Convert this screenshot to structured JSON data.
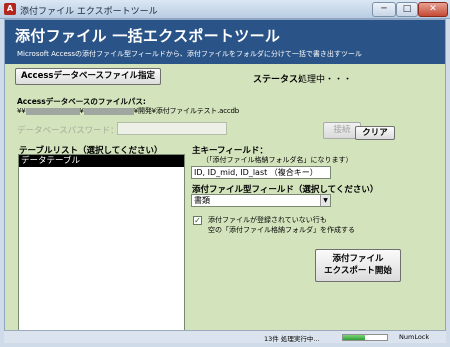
{
  "window": {
    "title": "添付ファイル エクスポートツール",
    "app_icon_letter": "A",
    "controls": {
      "minimize": "─",
      "maximize": "□",
      "close": "✕"
    }
  },
  "banner": {
    "title": "添付ファイル 一括エクスポートツール",
    "subtitle": "Microsoft Accessの添付ファイル型フィールドから、添付ファイルをフォルダに分けて一括で書き出すツール"
  },
  "database": {
    "select_button": "Accessデータベースファイル指定",
    "path_label": "Accessデータベースのファイルパス:",
    "path_prefix": "¥¥",
    "path_sep": "¥",
    "path_suffix": "¥開発¥添付ファイルテスト.accdb",
    "password_label": "データベースパスワード：",
    "password_value": "",
    "connect_button": "接続",
    "clear_button": "クリア"
  },
  "status": {
    "label": "ステータス:",
    "value": "処理中・・・"
  },
  "table_list": {
    "heading": "テーブルリスト（選択してください）",
    "items": [
      {
        "label": "データテーブル",
        "selected": true
      }
    ]
  },
  "primary_key": {
    "heading": "主キーフィールド：",
    "note": "（「添付ファイル格納フォルダ名」になります）",
    "value": "ID, ID_mid, ID_last （複合キー）"
  },
  "attachment_field": {
    "heading": "添付ファイル型フィールド（選択してください）",
    "selected": "書類"
  },
  "option": {
    "checked": true,
    "line1": "添付ファイルが登録されていない行も",
    "line2": "空の「添付ファイル格納フォルダ」を作成する"
  },
  "export_button": {
    "line1": "添付ファイル",
    "line2": "エクスポート開始"
  },
  "statusbar": {
    "text": "13件 処理実行中...",
    "progress_percent": 50,
    "numlock": "NumLock"
  },
  "icons": {
    "checkbox": "check-icon",
    "dropdown": "chevron-down-icon"
  },
  "colors": {
    "banner": "#2a5488",
    "form_background": "#d3e3bc",
    "list_selection": "#000000"
  }
}
